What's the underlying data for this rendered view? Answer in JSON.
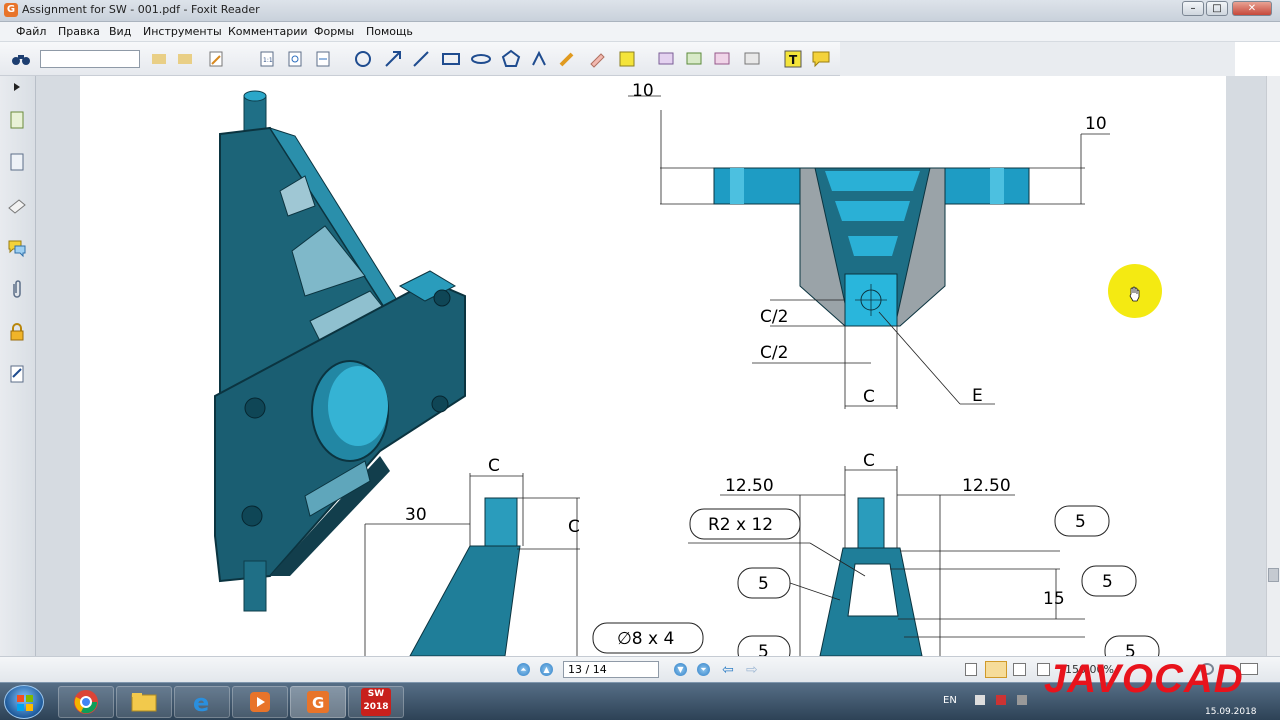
{
  "window": {
    "title": "Assignment for SW - 001.pdf - Foxit Reader",
    "app_icon": "G",
    "minimize": "–",
    "maximize": "□",
    "close": "✕"
  },
  "menu": {
    "items": [
      "Файл",
      "Правка",
      "Вид",
      "Инструменты",
      "Комментарии",
      "Формы",
      "Помощь"
    ]
  },
  "toolbar": {
    "search_value": ""
  },
  "drawing": {
    "top_left_dim": "10",
    "top_right_dim": "10",
    "c_half_1": "C/2",
    "c_half_2": "C/2",
    "c_front": "C",
    "e_label": "E",
    "side_c_top": "C",
    "side_30": "30",
    "side_c_right": "C",
    "hole_label": "∅8 x 4",
    "bot_c": "C",
    "bot_1250_left": "12.50",
    "bot_1250_right": "12.50",
    "radius_label": "R2 x 12",
    "five_1": "5",
    "five_2": "5",
    "five_3": "5",
    "five_4": "5",
    "five_5": "5",
    "fifteen": "15"
  },
  "statusbar": {
    "page": "13 / 14",
    "zoom": "150.00%"
  },
  "taskbar": {
    "lang": "EN",
    "date": "15.09.2018",
    "sw_label": "2018"
  },
  "watermark": "JAVOCAD",
  "colors": {
    "part": "#1f6f86",
    "part_light": "#2aa7c9",
    "accent_cursor": "#f4ea12",
    "watermark": "#e8131c"
  }
}
